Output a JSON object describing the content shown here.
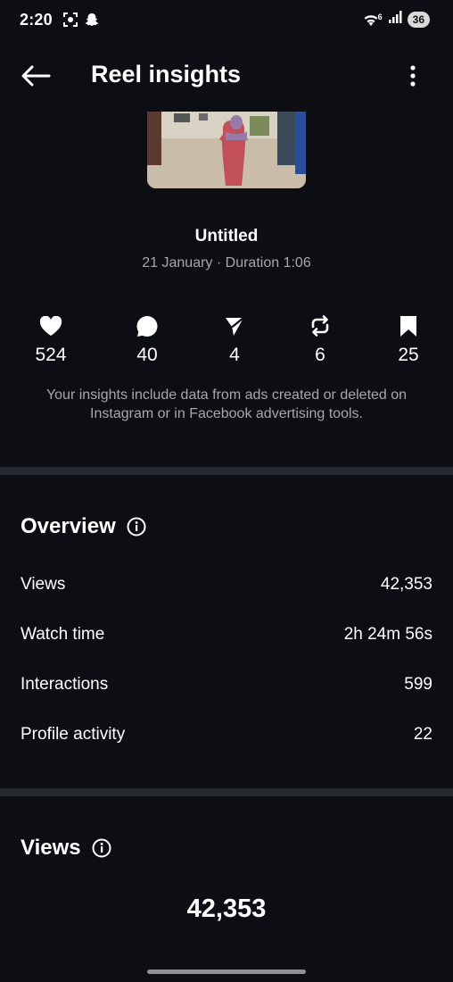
{
  "status_bar": {
    "time": "2:20",
    "battery": "36",
    "wifi_badge": "6"
  },
  "header": {
    "title": "Reel insights"
  },
  "reel": {
    "title": "Untitled",
    "meta": "21 January · Duration 1:06"
  },
  "stats": {
    "likes": "524",
    "comments": "40",
    "shares": "4",
    "reposts": "6",
    "saves": "25"
  },
  "notice": "Your insights include data from ads created or deleted on Instagram or in Facebook advertising tools.",
  "overview": {
    "heading": "Overview",
    "rows": [
      {
        "label": "Views",
        "value": "42,353"
      },
      {
        "label": "Watch time",
        "value": "2h 24m 56s"
      },
      {
        "label": "Interactions",
        "value": "599"
      },
      {
        "label": "Profile activity",
        "value": "22"
      }
    ]
  },
  "views_section": {
    "heading": "Views",
    "total": "42,353"
  },
  "icons": {
    "back": "arrow-left-icon",
    "more": "more-vertical-icon",
    "likes": "heart-icon",
    "comments": "comment-icon",
    "shares": "send-icon",
    "reposts": "repost-icon",
    "saves": "bookmark-icon",
    "info": "info-icon"
  },
  "colors": {
    "background": "#0c0e14",
    "secondary_text": "#a6a8ae",
    "divider": "#262a33"
  }
}
